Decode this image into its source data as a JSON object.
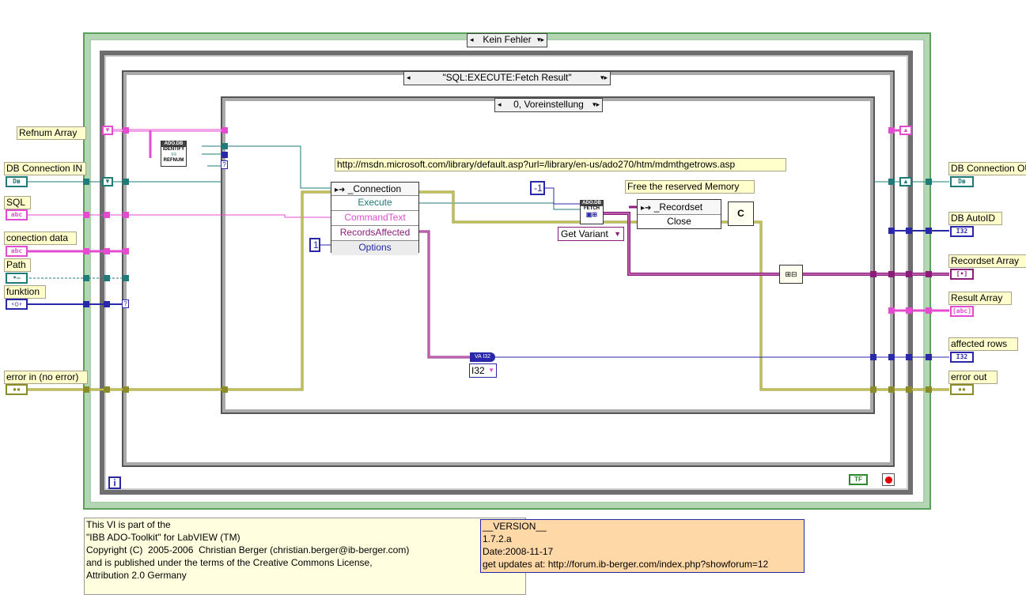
{
  "case_selectors": {
    "outer": "Kein Fehler",
    "middle": "\"SQL:EXECUTE:Fetch Result\"",
    "inner": "0, Voreinstellung"
  },
  "inputs": {
    "refnum_array": "Refnum Array",
    "db_connection_in": "DB Connection IN",
    "sql": "SQL",
    "connection_data": "conection data",
    "path": "Path",
    "funktion": "funktion",
    "error_in": "error in (no error)"
  },
  "outputs": {
    "db_connection_out": "DB Connection OUT",
    "db_autoid": "DB AutoID",
    "recordset_array": "Recordset Array",
    "result_array": "Result Array",
    "affected_rows": "affected rows",
    "error_out": "error out"
  },
  "terminal_glyphs": {
    "refnum": "Dʙ",
    "string": "abc",
    "path": "•—",
    "cluster": "‹○›",
    "i32": "I32",
    "array": "[•]",
    "string_array": "[abc]",
    "error": "▪▪"
  },
  "connection_node": {
    "title": "_Connection",
    "rows": [
      "Execute",
      "CommandText",
      "RecordsAffected",
      "Options"
    ]
  },
  "recordset_node": {
    "title": "_Recordset",
    "method": "Close"
  },
  "identify_node": [
    "ADO.DB",
    "IDENTIFY",
    "REFNUM"
  ],
  "fetch_node": [
    "ADO.DB",
    "FETCH"
  ],
  "constants": {
    "options": "1",
    "minus_one": "-1",
    "get_variant": "Get Variant",
    "i32_type": "I32",
    "to_i32": "I32",
    "to_i32_prefix": "VA"
  },
  "url_label": "http://msdn.microsoft.com/library/default.asp?url=/library/en-us/ado270/htm/mdmthgetrows.asp",
  "free_memory_label": "Free the reserved Memory",
  "loop_info": "i",
  "while_true": "TF",
  "close_ref_text": "C",
  "comment_left": "This VI is part of the\n\"IBB ADO-Toolkit\" for LabVIEW (TM)\nCopyright (C)  2005-2006  Christian Berger (christian.berger@ib-berger.com)\nand is published under the terms of the Creative Commons License,\nAttribution 2.0 Germany",
  "comment_right": "__VERSION__\n1.7.2.a\nDate:2008-11-17\nget updates at: http://forum.ib-berger.com/index.php?showforum=12",
  "colors": {
    "refnum_wire": "#1e7b78",
    "string_wire": "#e54bd1",
    "int_wire": "#2828a8",
    "error_wire": "#8b8b2a",
    "variant_wire": "#8b1c7a",
    "case_frame": "#b4d6b4",
    "comment_yellow": "#ffffe0",
    "comment_orange": "#ffd8a8"
  }
}
